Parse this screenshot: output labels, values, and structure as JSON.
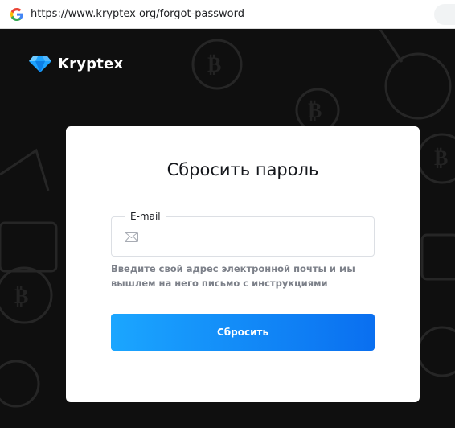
{
  "browser": {
    "url": "https://www.kryptex org/forgot-password",
    "favicon_icon": "google-g-icon"
  },
  "brand": {
    "name": "Kryptex",
    "logo_icon": "diamond-icon",
    "accent": "#1ea4ff"
  },
  "form": {
    "title": "Сбросить пароль",
    "email_label": "E-mail",
    "email_value": "",
    "email_icon": "envelope-icon",
    "hint": "Введите свой адрес электронной почты и мы вышлем на него письмо с инструкциями",
    "submit_label": "Сбросить",
    "button_colors": [
      "#1ba6ff",
      "#0a6ff0"
    ]
  }
}
